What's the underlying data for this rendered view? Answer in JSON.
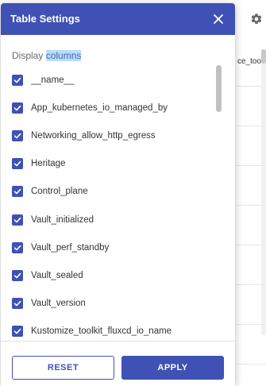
{
  "background": {
    "gear_icon": "gear-icon",
    "column_header_text": "ce_tool"
  },
  "dialog": {
    "title": "Table Settings",
    "close_icon": "close-icon",
    "section_label_prefix": "Display ",
    "section_label_highlight": "columns",
    "columns": [
      {
        "label": "__name__",
        "checked": true
      },
      {
        "label": "App_kubernetes_io_managed_by",
        "checked": true
      },
      {
        "label": "Networking_allow_http_egress",
        "checked": true
      },
      {
        "label": "Heritage",
        "checked": true
      },
      {
        "label": "Control_plane",
        "checked": true
      },
      {
        "label": "Vault_initialized",
        "checked": true
      },
      {
        "label": "Vault_perf_standby",
        "checked": true
      },
      {
        "label": "Vault_sealed",
        "checked": true
      },
      {
        "label": "Vault_version",
        "checked": true
      },
      {
        "label": "Kustomize_toolkit_fluxcd_io_name",
        "checked": true
      }
    ],
    "reset_label": "RESET",
    "apply_label": "APPLY"
  },
  "colors": {
    "primary": "#3f51b5",
    "highlight": "#bcdcfb"
  }
}
